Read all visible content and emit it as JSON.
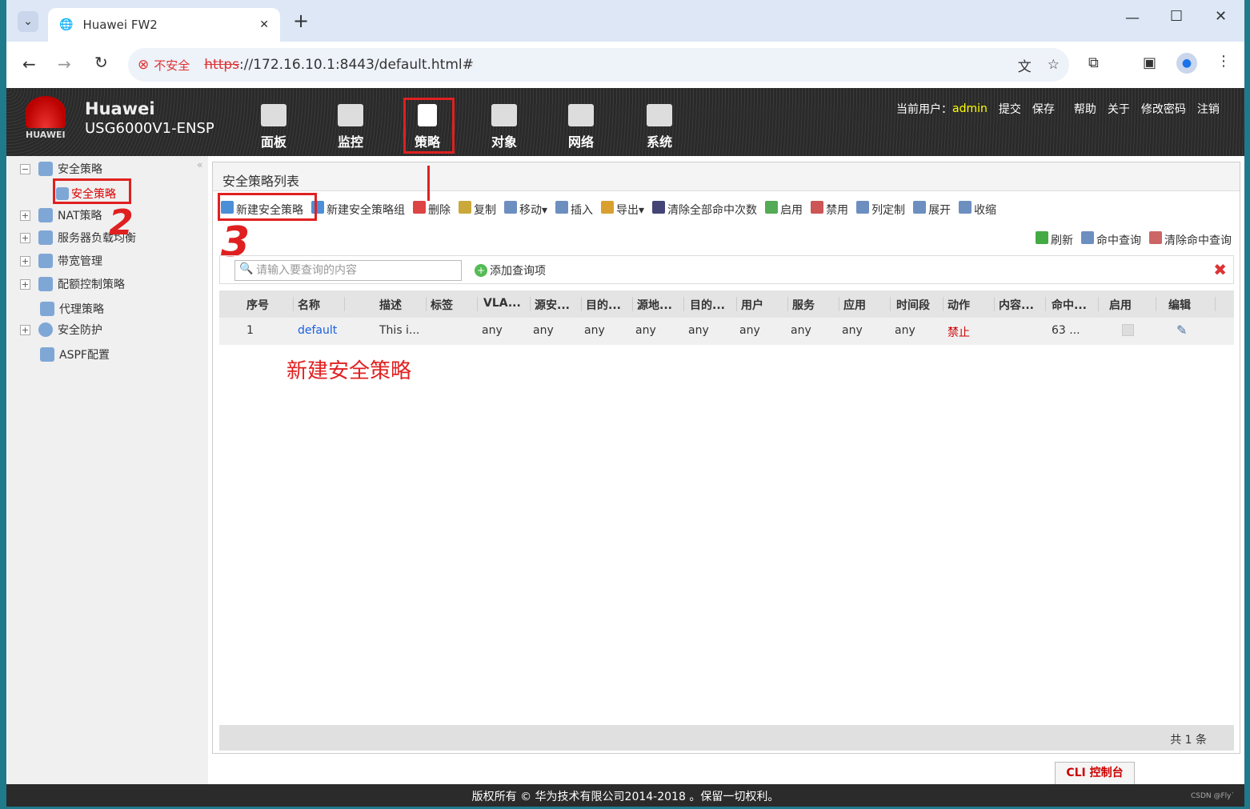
{
  "browser": {
    "tab_title": "Huawei FW2",
    "insecure": "不安全",
    "url_scheme": "https",
    "url_rest": "://172.16.10.1:8443/default.html#"
  },
  "header": {
    "brand": "Huawei",
    "model": "USG6000V1-ENSP",
    "logo_text": "HUAWEI",
    "nav": [
      {
        "label": "面板",
        "icon": "dashboard-icon"
      },
      {
        "label": "监控",
        "icon": "monitor-icon"
      },
      {
        "label": "策略",
        "icon": "policy-icon",
        "active": true
      },
      {
        "label": "对象",
        "icon": "object-icon"
      },
      {
        "label": "网络",
        "icon": "network-icon"
      },
      {
        "label": "系统",
        "icon": "system-icon"
      }
    ],
    "user_label": "当前用户：",
    "user": "admin",
    "links": [
      "提交",
      "保存",
      "帮助",
      "关于",
      "修改密码",
      "注销"
    ]
  },
  "sidebar": {
    "items": [
      {
        "label": "安全策略",
        "toggle": "−"
      },
      {
        "label": "安全策略",
        "child": true,
        "selected": true
      },
      {
        "label": "NAT策略",
        "toggle": "+"
      },
      {
        "label": "服务器负载均衡",
        "toggle": "+"
      },
      {
        "label": "带宽管理",
        "toggle": "+"
      },
      {
        "label": "配额控制策略",
        "toggle": "+"
      },
      {
        "label": "代理策略"
      },
      {
        "label": "安全防护",
        "toggle": "+"
      },
      {
        "label": "ASPF配置"
      }
    ]
  },
  "main": {
    "title": "安全策略列表",
    "toolbar": [
      "新建安全策略",
      "新建安全策略组",
      "删除",
      "复制",
      "移动▾",
      "插入",
      "导出▾",
      "清除全部命中次数",
      "启用",
      "禁用",
      "列定制",
      "展开",
      "收缩"
    ],
    "toolbar2": [
      "刷新",
      "命中查询",
      "清除命中查询"
    ],
    "search_placeholder": "请输入要查询的内容",
    "add_query": "添加查询项",
    "columns": [
      "序号",
      "名称",
      "描述",
      "标签",
      "VLA...",
      "源安...",
      "目的...",
      "源地...",
      "目的...",
      "用户",
      "服务",
      "应用",
      "时间段",
      "动作",
      "内容...",
      "命中...",
      "启用",
      "编辑"
    ],
    "rows": [
      [
        "1",
        "default",
        "This i...",
        "",
        "any",
        "any",
        "any",
        "any",
        "any",
        "any",
        "any",
        "any",
        "any",
        "禁止",
        "",
        "63 ...",
        "",
        ""
      ]
    ],
    "total": "共 1 条"
  },
  "annotation": {
    "text": "新建安全策略",
    "color": "#e02020",
    "marks": [
      "2",
      "3"
    ]
  },
  "footer": {
    "copyright": "版权所有 © 华为技术有限公司2014-2018 。保留一切权利。",
    "cli": "CLI 控制台",
    "watermark": "CSDN @Fly`"
  }
}
